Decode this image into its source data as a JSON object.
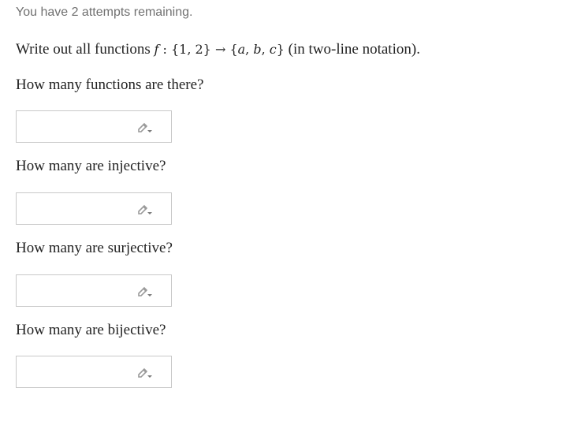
{
  "status": {
    "attempts_text": "You have 2 attempts remaining."
  },
  "question": {
    "prefix": "Write out all functions",
    "f": "f",
    "colon": " : ",
    "domain": "{1, 2}",
    "arrow": " → ",
    "codomain_open": "{",
    "a": "a",
    "b": "b",
    "c": "c",
    "codomain_close": "}",
    "suffix": "(in two-line notation)."
  },
  "parts": [
    {
      "label": "How many functions are there?",
      "value": ""
    },
    {
      "label": "How many are injective?",
      "value": ""
    },
    {
      "label": "How many are surjective?",
      "value": ""
    },
    {
      "label": "How many are bijective?",
      "value": ""
    }
  ],
  "icons": {
    "edit": "pencil-dropdown-icon"
  },
  "colors": {
    "muted_text": "#707070",
    "box_border": "#c8c8c8",
    "icon": "#9a9a9a"
  }
}
